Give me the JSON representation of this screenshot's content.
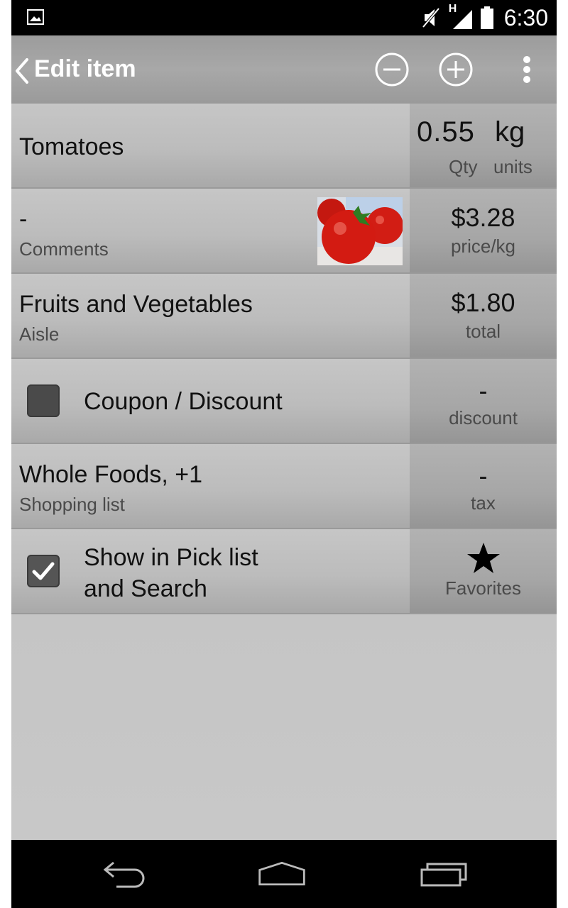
{
  "status_bar": {
    "time": "6:30",
    "network_label": "H",
    "icons": [
      "image-notification-icon",
      "mute-icon",
      "signal-icon",
      "battery-icon"
    ]
  },
  "action_bar": {
    "title": "Edit item",
    "actions": [
      "back-chevron-icon",
      "minus-circle-icon",
      "plus-circle-icon",
      "overflow-menu-icon"
    ]
  },
  "rows": {
    "item": {
      "name": "Tomatoes",
      "qty": "0.55",
      "unit": "kg",
      "qty_label": "Qty",
      "units_label": "units"
    },
    "comments": {
      "value": "-",
      "label": "Comments",
      "price": "$3.28",
      "price_label": "price/kg"
    },
    "aisle": {
      "value": "Fruits and Vegetables",
      "label": "Aisle",
      "total": "$1.80",
      "total_label": "total"
    },
    "coupon": {
      "label": "Coupon / Discount",
      "checked": false,
      "discount": "-",
      "discount_label": "discount"
    },
    "shopping_list": {
      "value": "Whole Foods, +1",
      "label": "Shopping list",
      "tax": "-",
      "tax_label": "tax"
    },
    "pick_list": {
      "label_line1": "Show in Pick list",
      "label_line2": "and Search",
      "checked": true,
      "favorites_label": "Favorites"
    }
  },
  "nav_bar": {
    "buttons": [
      "back-icon",
      "home-icon",
      "recents-icon"
    ]
  },
  "colors": {
    "accent_white": "#ffffff",
    "row_bg": "#bcbcbc",
    "side_bg": "#a6a6a6",
    "text": "#111111",
    "secondary_text": "#4a4a4a"
  }
}
